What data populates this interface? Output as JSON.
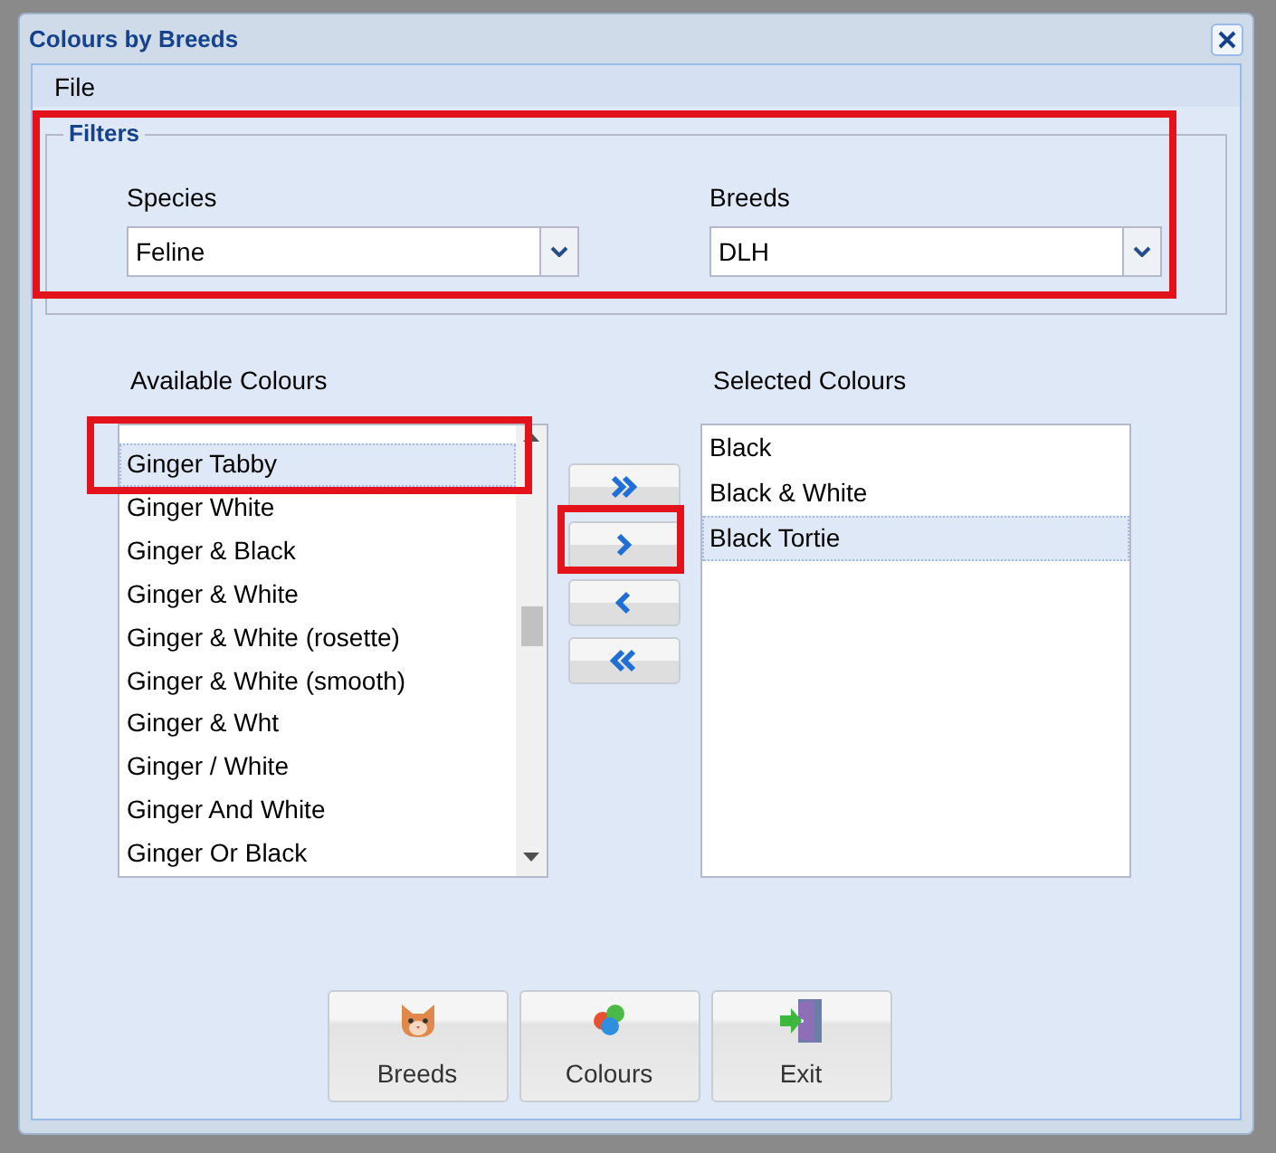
{
  "window": {
    "title": "Colours by Breeds"
  },
  "menu": [
    {
      "label": "File"
    }
  ],
  "filters": {
    "legend": "Filters",
    "highlighted": true,
    "fields": [
      {
        "label": "Species",
        "value": "Feline"
      },
      {
        "label": "Breeds",
        "value": "DLH"
      }
    ]
  },
  "available": {
    "label": "Available Colours",
    "items": [
      {
        "text": "Ginger Tabby",
        "selected": true,
        "highlighted": true
      },
      {
        "text": "Ginger White",
        "selected": false,
        "highlighted": false
      },
      {
        "text": "Ginger & Black",
        "selected": false,
        "highlighted": false
      },
      {
        "text": "Ginger & White",
        "selected": false,
        "highlighted": false
      },
      {
        "text": "Ginger & White (rosette)",
        "selected": false,
        "highlighted": false
      },
      {
        "text": "Ginger & White (smooth)",
        "selected": false,
        "highlighted": false
      },
      {
        "text": "Ginger & Wht",
        "selected": false,
        "highlighted": false
      },
      {
        "text": "Ginger / White",
        "selected": false,
        "highlighted": false
      },
      {
        "text": "Ginger And White",
        "selected": false,
        "highlighted": false
      },
      {
        "text": "Ginger Or Black",
        "selected": false,
        "highlighted": false
      }
    ]
  },
  "transfer": [
    {
      "kind": "add-all",
      "highlighted": false
    },
    {
      "kind": "add",
      "highlighted": true
    },
    {
      "kind": "remove",
      "highlighted": false
    },
    {
      "kind": "remove-all",
      "highlighted": false
    }
  ],
  "selected_colours": {
    "label": "Selected Colours",
    "items": [
      {
        "text": "Black",
        "selected": false
      },
      {
        "text": "Black & White",
        "selected": false
      },
      {
        "text": "Black Tortie",
        "selected": true
      }
    ]
  },
  "buttons": [
    {
      "kind": "breeds",
      "label": "Breeds"
    },
    {
      "kind": "colours",
      "label": "Colours"
    },
    {
      "kind": "exit",
      "label": "Exit"
    }
  ]
}
